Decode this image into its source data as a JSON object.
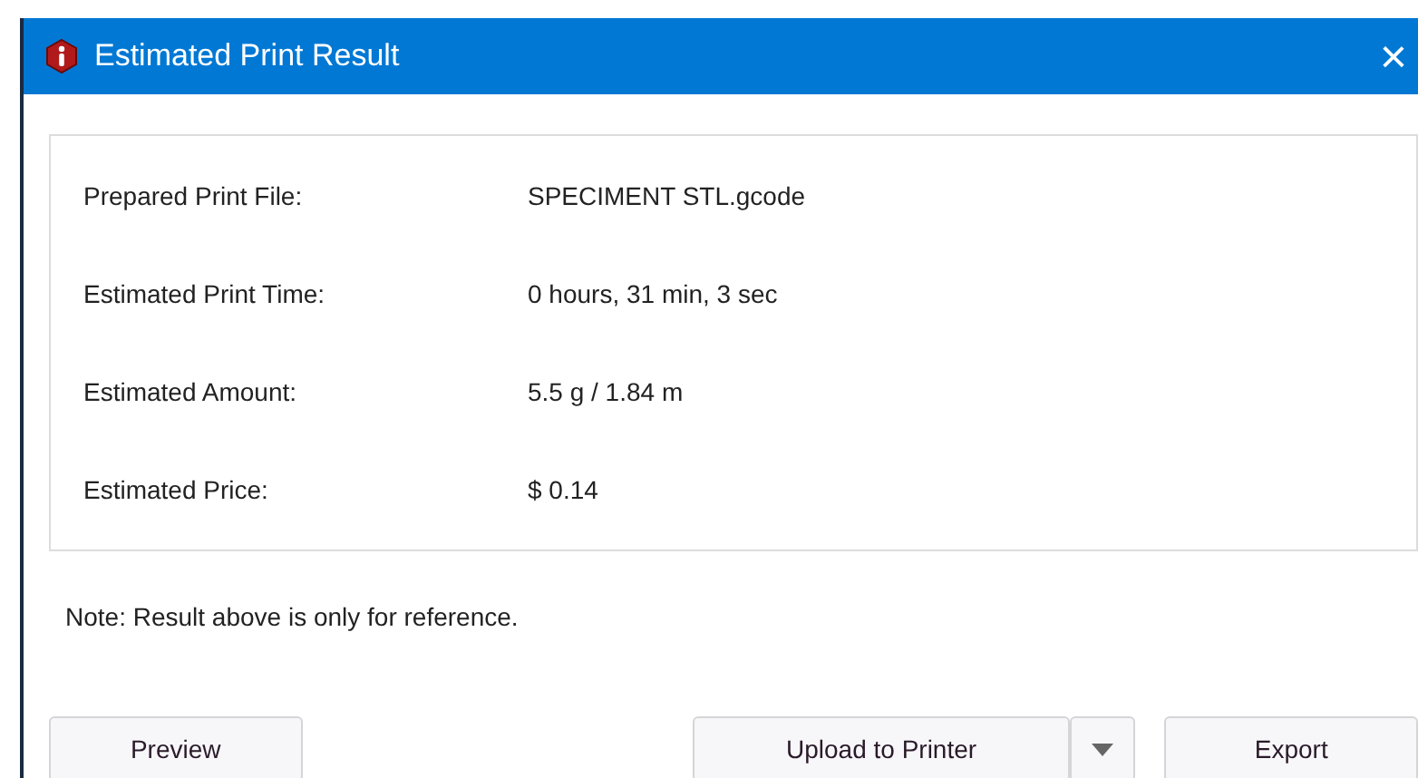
{
  "window": {
    "title": "Estimated Print Result",
    "close": "×"
  },
  "fields": [
    {
      "label": "Prepared Print File:",
      "value": "SPECIMENT STL.gcode"
    },
    {
      "label": "Estimated Print Time:",
      "value": "0 hours, 31 min, 3 sec"
    },
    {
      "label": "Estimated Amount:",
      "value": "5.5 g / 1.84 m"
    },
    {
      "label": "Estimated Price:",
      "value": "$ 0.14"
    }
  ],
  "note": "Note: Result above is only for reference.",
  "buttons": {
    "preview": "Preview",
    "upload": "Upload to Printer",
    "export": "Export"
  }
}
